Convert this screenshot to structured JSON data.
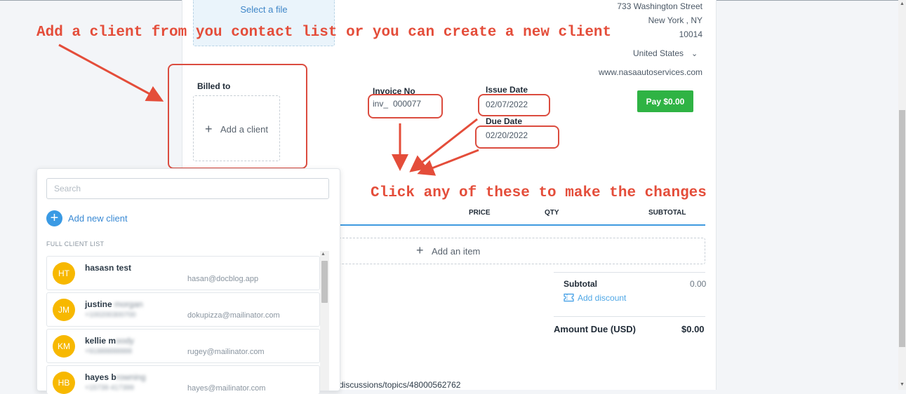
{
  "header": {
    "select_file": "Select a file",
    "address_line1": "733 Washington Street",
    "address_city": "New York ,  NY",
    "address_zip": "10014",
    "country": "United States",
    "website": "www.nasaautoservices.com"
  },
  "annotations": {
    "top": "Add a client from you contact list or you can create a new client",
    "middle": "Click any of these to make the changes"
  },
  "billed": {
    "label": "Billed to",
    "add_client": "Add a client"
  },
  "invoice": {
    "no_label": "Invoice No",
    "no_prefix": "inv_",
    "no_value": "000077",
    "issue_label": "Issue Date",
    "issue_value": "02/07/2022",
    "due_label": "Due Date",
    "due_value": "02/20/2022"
  },
  "pay_button": "Pay $0.00",
  "table": {
    "col_price": "PRICE",
    "col_qty": "QTY",
    "col_subtotal": "SUBTOTAL",
    "add_item": "Add an item"
  },
  "summary": {
    "subtotal_label": "Subtotal",
    "subtotal_value": "0.00",
    "add_discount": "Add discount",
    "amount_due_label": "Amount Due (USD)",
    "amount_due_value": "$0.00"
  },
  "footer_link": "discussions/topics/48000562762",
  "client_panel": {
    "search_placeholder": "Search",
    "add_new": "Add new client",
    "list_header": "FULL CLIENT LIST",
    "clients": [
      {
        "initials": "HT",
        "first": "hasasn test",
        "rest": "",
        "phone": "",
        "email": "hasan@docblog.app"
      },
      {
        "initials": "JM",
        "first": "justine",
        "rest": "morgan",
        "phone": "+100200300700",
        "email": "dokupizza@mailinator.com"
      },
      {
        "initials": "KM",
        "first": "kellie m",
        "rest": "oody",
        "phone": "+91888888888",
        "email": "rugey@mailinator.com"
      },
      {
        "initials": "HB",
        "first": "hayes b",
        "rest": "rowning",
        "phone": "+15739 417399",
        "email": "hayes@mailinator.com"
      }
    ]
  },
  "colors": {
    "annotation": "#e44d3a",
    "pay": "#2fb344",
    "accent": "#3a9ae4",
    "avatar": "#f7b800"
  }
}
